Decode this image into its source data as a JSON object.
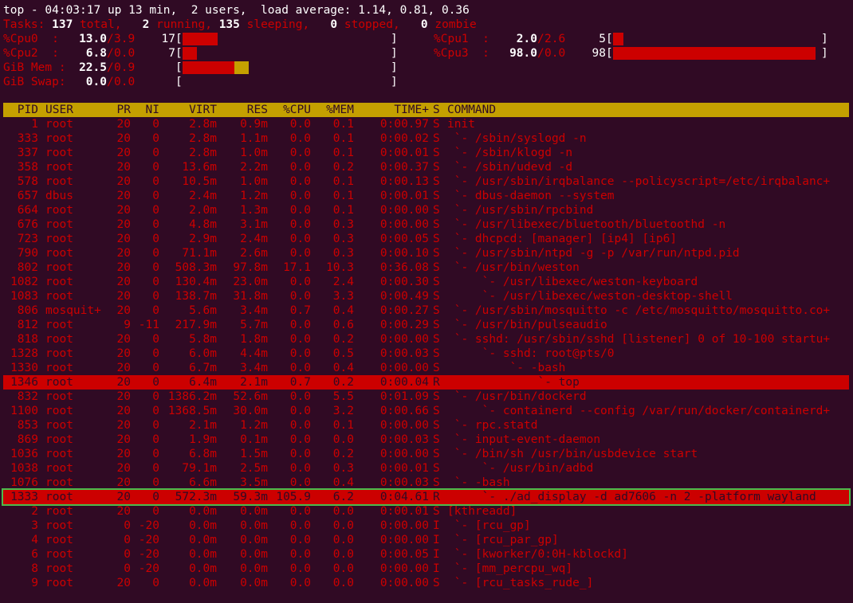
{
  "summary": {
    "line1": "top - 04:03:17 up 13 min,  2 users,  load average: 1.14, 0.81, 0.36",
    "tasks_label": "Tasks:",
    "tasks_total": "137",
    "tasks_total_label": " total,",
    "tasks_running": "2",
    "tasks_running_label": " running,",
    "tasks_sleeping": "135",
    "tasks_sleeping_label": " sleeping,",
    "tasks_stopped": "0",
    "tasks_stopped_label": " stopped,",
    "tasks_zombie": "0",
    "tasks_zombie_label": " zombie"
  },
  "meters": [
    {
      "label": "%Cpu0  :",
      "value": "13.0",
      "sep": "/",
      "value2": "3.9",
      "pct": "17",
      "open": "[",
      "close": "]",
      "fill_fraction": 0.17,
      "color": "#cc0000"
    },
    {
      "label": "%Cpu1  :",
      "value": "2.0",
      "sep": "/",
      "value2": "2.6",
      "pct": "5",
      "open": "[",
      "close": "]",
      "fill_fraction": 0.05,
      "color": "#cc0000"
    },
    {
      "label": "%Cpu2  :",
      "value": "6.8",
      "sep": "/",
      "value2": "0.0",
      "pct": "7",
      "open": "[",
      "close": "]",
      "fill_fraction": 0.07,
      "color": "#cc0000"
    },
    {
      "label": "%Cpu3  :",
      "value": "98.0",
      "sep": "/",
      "value2": "0.0",
      "pct": "98",
      "open": "[",
      "close": "]",
      "fill_fraction": 0.98,
      "color": "#cc0000"
    },
    {
      "label": "GiB Mem :",
      "value": "22.5",
      "sep": "/",
      "value2": "0.9",
      "pct": "",
      "open": "[",
      "close": "]",
      "fill_fraction": 0.25,
      "color": "#cc0000",
      "fill2_fraction": 0.07,
      "color2": "#c4a000"
    },
    {
      "label": "GiB Swap:",
      "value": "0.0",
      "sep": "/",
      "value2": "0.0",
      "pct": "",
      "open": "[",
      "close": "]",
      "fill_fraction": 0,
      "color": "#cc0000"
    }
  ],
  "header": {
    "pid": "PID",
    "user": "USER",
    "pr": "PR",
    "ni": "NI",
    "virt": "VIRT",
    "res": "RES",
    "cpu": "%CPU",
    "mem": "%MEM",
    "time": "TIME+",
    "s": "S",
    "cmd": "COMMAND"
  },
  "processes": [
    {
      "pid": "1",
      "user": "root",
      "pr": "20",
      "ni": "0",
      "virt": "2.8m",
      "res": "0.9m",
      "cpu": "0.0",
      "mem": "0.1",
      "time": "0:00.97",
      "s": "S",
      "cmd": "init"
    },
    {
      "pid": "333",
      "user": "root",
      "pr": "20",
      "ni": "0",
      "virt": "2.8m",
      "res": "1.1m",
      "cpu": "0.0",
      "mem": "0.1",
      "time": "0:00.02",
      "s": "S",
      "cmd": " `- /sbin/syslogd -n"
    },
    {
      "pid": "337",
      "user": "root",
      "pr": "20",
      "ni": "0",
      "virt": "2.8m",
      "res": "1.0m",
      "cpu": "0.0",
      "mem": "0.1",
      "time": "0:00.01",
      "s": "S",
      "cmd": " `- /sbin/klogd -n"
    },
    {
      "pid": "358",
      "user": "root",
      "pr": "20",
      "ni": "0",
      "virt": "13.6m",
      "res": "2.2m",
      "cpu": "0.0",
      "mem": "0.2",
      "time": "0:00.37",
      "s": "S",
      "cmd": " `- /sbin/udevd -d"
    },
    {
      "pid": "578",
      "user": "root",
      "pr": "20",
      "ni": "0",
      "virt": "10.5m",
      "res": "1.0m",
      "cpu": "0.0",
      "mem": "0.1",
      "time": "0:00.13",
      "s": "S",
      "cmd": " `- /usr/sbin/irqbalance --policyscript=/etc/irqbalanc+"
    },
    {
      "pid": "657",
      "user": "dbus",
      "pr": "20",
      "ni": "0",
      "virt": "2.4m",
      "res": "1.2m",
      "cpu": "0.0",
      "mem": "0.1",
      "time": "0:00.01",
      "s": "S",
      "cmd": " `- dbus-daemon --system"
    },
    {
      "pid": "664",
      "user": "root",
      "pr": "20",
      "ni": "0",
      "virt": "2.0m",
      "res": "1.3m",
      "cpu": "0.0",
      "mem": "0.1",
      "time": "0:00.00",
      "s": "S",
      "cmd": " `- /usr/sbin/rpcbind"
    },
    {
      "pid": "676",
      "user": "root",
      "pr": "20",
      "ni": "0",
      "virt": "4.8m",
      "res": "3.1m",
      "cpu": "0.0",
      "mem": "0.3",
      "time": "0:00.00",
      "s": "S",
      "cmd": " `- /usr/libexec/bluetooth/bluetoothd -n"
    },
    {
      "pid": "723",
      "user": "root",
      "pr": "20",
      "ni": "0",
      "virt": "2.9m",
      "res": "2.4m",
      "cpu": "0.0",
      "mem": "0.3",
      "time": "0:00.05",
      "s": "S",
      "cmd": " `- dhcpcd: [manager] [ip4] [ip6]"
    },
    {
      "pid": "790",
      "user": "root",
      "pr": "20",
      "ni": "0",
      "virt": "71.1m",
      "res": "2.6m",
      "cpu": "0.0",
      "mem": "0.3",
      "time": "0:00.10",
      "s": "S",
      "cmd": " `- /usr/sbin/ntpd -g -p /var/run/ntpd.pid"
    },
    {
      "pid": "802",
      "user": "root",
      "pr": "20",
      "ni": "0",
      "virt": "508.3m",
      "res": "97.8m",
      "cpu": "17.1",
      "mem": "10.3",
      "time": "0:36.08",
      "s": "S",
      "cmd": " `- /usr/bin/weston"
    },
    {
      "pid": "1082",
      "user": "root",
      "pr": "20",
      "ni": "0",
      "virt": "130.4m",
      "res": "23.0m",
      "cpu": "0.0",
      "mem": "2.4",
      "time": "0:00.30",
      "s": "S",
      "cmd": "     `- /usr/libexec/weston-keyboard"
    },
    {
      "pid": "1083",
      "user": "root",
      "pr": "20",
      "ni": "0",
      "virt": "138.7m",
      "res": "31.8m",
      "cpu": "0.0",
      "mem": "3.3",
      "time": "0:00.49",
      "s": "S",
      "cmd": "     `- /usr/libexec/weston-desktop-shell"
    },
    {
      "pid": "806",
      "user": "mosquit+",
      "pr": "20",
      "ni": "0",
      "virt": "5.6m",
      "res": "3.4m",
      "cpu": "0.7",
      "mem": "0.4",
      "time": "0:00.27",
      "s": "S",
      "cmd": " `- /usr/sbin/mosquitto -c /etc/mosquitto/mosquitto.co+"
    },
    {
      "pid": "812",
      "user": "root",
      "pr": "9",
      "ni": "-11",
      "virt": "217.9m",
      "res": "5.7m",
      "cpu": "0.0",
      "mem": "0.6",
      "time": "0:00.29",
      "s": "S",
      "cmd": " `- /usr/bin/pulseaudio"
    },
    {
      "pid": "818",
      "user": "root",
      "pr": "20",
      "ni": "0",
      "virt": "5.8m",
      "res": "1.8m",
      "cpu": "0.0",
      "mem": "0.2",
      "time": "0:00.00",
      "s": "S",
      "cmd": " `- sshd: /usr/sbin/sshd [listener] 0 of 10-100 startu+"
    },
    {
      "pid": "1328",
      "user": "root",
      "pr": "20",
      "ni": "0",
      "virt": "6.0m",
      "res": "4.4m",
      "cpu": "0.0",
      "mem": "0.5",
      "time": "0:00.03",
      "s": "S",
      "cmd": "     `- sshd: root@pts/0"
    },
    {
      "pid": "1330",
      "user": "root",
      "pr": "20",
      "ni": "0",
      "virt": "6.7m",
      "res": "3.4m",
      "cpu": "0.0",
      "mem": "0.4",
      "time": "0:00.00",
      "s": "S",
      "cmd": "         `- -bash"
    },
    {
      "pid": "1346",
      "user": "root",
      "pr": "20",
      "ni": "0",
      "virt": "6.4m",
      "res": "2.1m",
      "cpu": "0.7",
      "mem": "0.2",
      "time": "0:00.04",
      "s": "R",
      "cmd": "             `- top",
      "highlight": true
    },
    {
      "pid": "832",
      "user": "root",
      "pr": "20",
      "ni": "0",
      "virt": "1386.2m",
      "res": "52.6m",
      "cpu": "0.0",
      "mem": "5.5",
      "time": "0:01.09",
      "s": "S",
      "cmd": " `- /usr/bin/dockerd"
    },
    {
      "pid": "1100",
      "user": "root",
      "pr": "20",
      "ni": "0",
      "virt": "1368.5m",
      "res": "30.0m",
      "cpu": "0.0",
      "mem": "3.2",
      "time": "0:00.66",
      "s": "S",
      "cmd": "     `- containerd --config /var/run/docker/containerd+"
    },
    {
      "pid": "853",
      "user": "root",
      "pr": "20",
      "ni": "0",
      "virt": "2.1m",
      "res": "1.2m",
      "cpu": "0.0",
      "mem": "0.1",
      "time": "0:00.00",
      "s": "S",
      "cmd": " `- rpc.statd"
    },
    {
      "pid": "869",
      "user": "root",
      "pr": "20",
      "ni": "0",
      "virt": "1.9m",
      "res": "0.1m",
      "cpu": "0.0",
      "mem": "0.0",
      "time": "0:00.03",
      "s": "S",
      "cmd": " `- input-event-daemon"
    },
    {
      "pid": "1036",
      "user": "root",
      "pr": "20",
      "ni": "0",
      "virt": "6.8m",
      "res": "1.5m",
      "cpu": "0.0",
      "mem": "0.2",
      "time": "0:00.00",
      "s": "S",
      "cmd": " `- /bin/sh /usr/bin/usbdevice start"
    },
    {
      "pid": "1038",
      "user": "root",
      "pr": "20",
      "ni": "0",
      "virt": "79.1m",
      "res": "2.5m",
      "cpu": "0.0",
      "mem": "0.3",
      "time": "0:00.01",
      "s": "S",
      "cmd": "     `- /usr/bin/adbd"
    },
    {
      "pid": "1076",
      "user": "root",
      "pr": "20",
      "ni": "0",
      "virt": "6.6m",
      "res": "3.5m",
      "cpu": "0.0",
      "mem": "0.4",
      "time": "0:00.03",
      "s": "S",
      "cmd": " `- -bash"
    },
    {
      "pid": "1333",
      "user": "root",
      "pr": "20",
      "ni": "0",
      "virt": "572.3m",
      "res": "59.3m",
      "cpu": "105.9",
      "mem": "6.2",
      "time": "0:04.61",
      "s": "R",
      "cmd": "     `- ./ad_display -d ad7606 -n 2 -platform wayland",
      "highlight": true,
      "selected": true
    },
    {
      "pid": "2",
      "user": "root",
      "pr": "20",
      "ni": "0",
      "virt": "0.0m",
      "res": "0.0m",
      "cpu": "0.0",
      "mem": "0.0",
      "time": "0:00.01",
      "s": "S",
      "cmd": "[kthreadd]"
    },
    {
      "pid": "3",
      "user": "root",
      "pr": "0",
      "ni": "-20",
      "virt": "0.0m",
      "res": "0.0m",
      "cpu": "0.0",
      "mem": "0.0",
      "time": "0:00.00",
      "s": "I",
      "cmd": " `- [rcu_gp]"
    },
    {
      "pid": "4",
      "user": "root",
      "pr": "0",
      "ni": "-20",
      "virt": "0.0m",
      "res": "0.0m",
      "cpu": "0.0",
      "mem": "0.0",
      "time": "0:00.00",
      "s": "I",
      "cmd": " `- [rcu_par_gp]"
    },
    {
      "pid": "6",
      "user": "root",
      "pr": "0",
      "ni": "-20",
      "virt": "0.0m",
      "res": "0.0m",
      "cpu": "0.0",
      "mem": "0.0",
      "time": "0:00.05",
      "s": "I",
      "cmd": " `- [kworker/0:0H-kblockd]"
    },
    {
      "pid": "8",
      "user": "root",
      "pr": "0",
      "ni": "-20",
      "virt": "0.0m",
      "res": "0.0m",
      "cpu": "0.0",
      "mem": "0.0",
      "time": "0:00.00",
      "s": "I",
      "cmd": " `- [mm_percpu_wq]"
    },
    {
      "pid": "9",
      "user": "root",
      "pr": "20",
      "ni": "0",
      "virt": "0.0m",
      "res": "0.0m",
      "cpu": "0.0",
      "mem": "0.0",
      "time": "0:00.00",
      "s": "S",
      "cmd": " `- [rcu_tasks_rude_]"
    }
  ]
}
